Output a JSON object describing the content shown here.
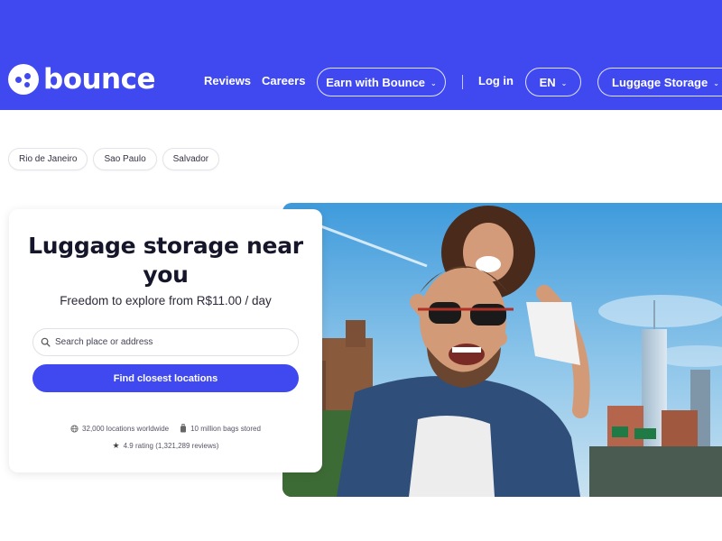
{
  "brand": {
    "name": "bounce"
  },
  "nav": {
    "reviews": "Reviews",
    "careers": "Careers",
    "earn": "Earn with Bounce",
    "login": "Log in",
    "language": "EN",
    "product": "Luggage Storage"
  },
  "cities": [
    "Rio de Janeiro",
    "Sao Paulo",
    "Salvador"
  ],
  "hero": {
    "title": "Luggage storage near you",
    "subtitle": "Freedom to explore from R$11.00 / day",
    "search_placeholder": "Search place or address",
    "cta": "Find closest locations",
    "stats": {
      "locations": "32,000 locations worldwide",
      "bags": "10 million bags stored",
      "rating": "4.9 rating (1,321,289 reviews)"
    }
  },
  "icons": {
    "search": "search-icon",
    "chevron": "chevron-down-icon",
    "globe": "globe-icon",
    "bag": "luggage-icon",
    "star": "star-icon"
  },
  "colors": {
    "brand": "#4049ef",
    "text": "#16162a",
    "white": "#ffffff"
  }
}
